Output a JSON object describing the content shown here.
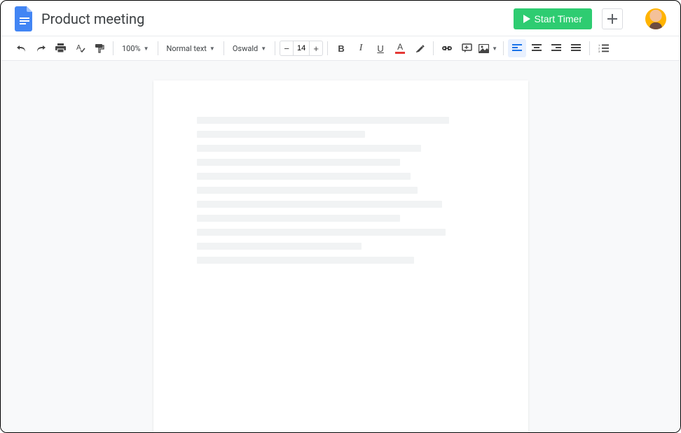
{
  "header": {
    "title": "Product meeting",
    "start_timer_label": "Start Timer"
  },
  "toolbar": {
    "zoom": "100%",
    "style": "Normal text",
    "font": "Oswald",
    "font_size": "14"
  },
  "placeholder_widths": [
    360,
    240,
    320,
    290,
    305,
    315,
    350,
    290,
    355,
    235,
    310
  ]
}
